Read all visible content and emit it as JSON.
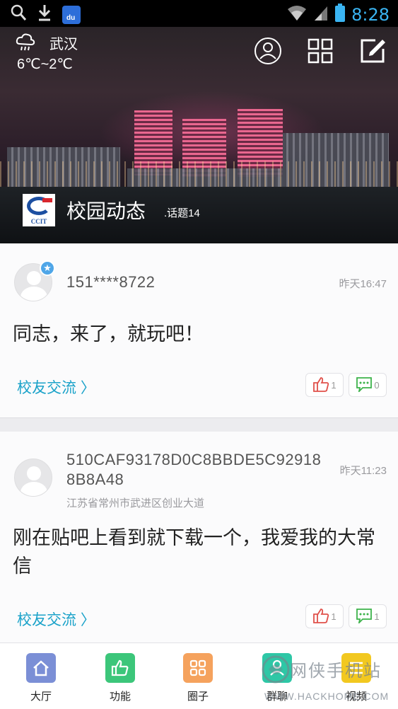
{
  "status_bar": {
    "time": "8:28",
    "baidu_label": "du"
  },
  "weather": {
    "city": "武汉",
    "temp": "6℃~2℃"
  },
  "hero": {
    "logo_text": "CCIT",
    "title": "校园动态",
    "topics": ".话题14"
  },
  "posts": [
    {
      "username": "151****8722",
      "time": "昨天16:47",
      "content": "同志，来了，就玩吧！",
      "tag": "校友交流 〉",
      "likes": "1",
      "comments": "0"
    },
    {
      "username": "510CAF93178D0C8BBDE5C92918\n8B8A48",
      "time": "昨天11:23",
      "location": "江苏省常州市武进区创业大道",
      "content": "刚在贴吧上看到就下载一个，我爱我的大常信",
      "tag": "校友交流 〉",
      "likes": "1",
      "comments": "1"
    }
  ],
  "tabs": [
    {
      "label": "大厅",
      "color": "#7b8fd6"
    },
    {
      "label": "功能",
      "color": "#3cc67a"
    },
    {
      "label": "圈子",
      "color": "#f5a25d"
    },
    {
      "label": "群聊",
      "color": "#2ec7a6"
    },
    {
      "label": "视频",
      "color": "#f2c820"
    }
  ],
  "watermark": {
    "text": "网侠手机站",
    "url": "WWW.HACKHOME.COM"
  },
  "colors": {
    "accent": "#1aa2c9",
    "like": "#e0504a",
    "comment": "#3cb24a"
  }
}
